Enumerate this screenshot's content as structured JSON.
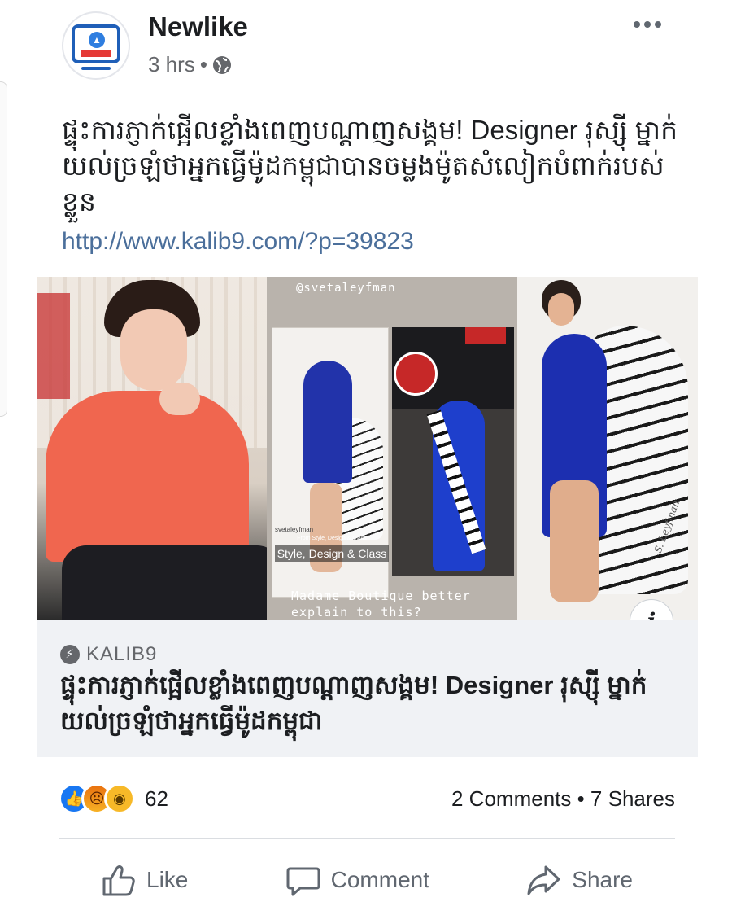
{
  "post": {
    "page_name": "Newlike",
    "time": "3 hrs",
    "separator": "•",
    "text": "ផ្ទុះការភ្ញាក់ផ្អើលខ្លាំងពេញបណ្ដាញសង្គម! Designer រុស្ស៊ី ម្នាក់យល់ច្រឡំថាអ្នកធ្វើម៉ូដកម្ពុជាបានចម្លងម៉ូតសំលៀកបំពាក់របស់ខ្លួន",
    "link": "http://www.kalib9.com/?p=39823"
  },
  "image": {
    "handle": "@svetaleyfman",
    "handle_small": "svetaleyfman",
    "style_sub": "From Style, Design & Class",
    "style_label": "Style, Design & Class",
    "caption": "Madame Boutique better explain to this?",
    "signature": "S. Leyfman",
    "info": "i"
  },
  "preview": {
    "domain": "KALIB9",
    "title": "ផ្ទុះការភ្ញាក់ផ្អើលខ្លាំងពេញបណ្ដាញសង្គម! Designer រុស្ស៊ី ម្នាក់យល់ច្រឡំថាអ្នកធ្វើម៉ូដកម្ពុជា"
  },
  "engagement": {
    "reaction_count": "62",
    "stats": "2 Comments • 7 Shares"
  },
  "actions": {
    "like": "Like",
    "comment": "Comment",
    "share": "Share"
  },
  "colors": {
    "link": "#4b6f9b",
    "like_blue": "#1877f2",
    "muted": "#65676b",
    "preview_bg": "#f0f2f5"
  },
  "icons": [
    "page-avatar-logo",
    "globe-icon",
    "more-options-icon",
    "info-icon",
    "bolt-icon",
    "like-reaction-icon",
    "angry-reaction-icon",
    "wow-reaction-icon",
    "thumbs-up-icon",
    "comment-icon",
    "share-icon"
  ]
}
